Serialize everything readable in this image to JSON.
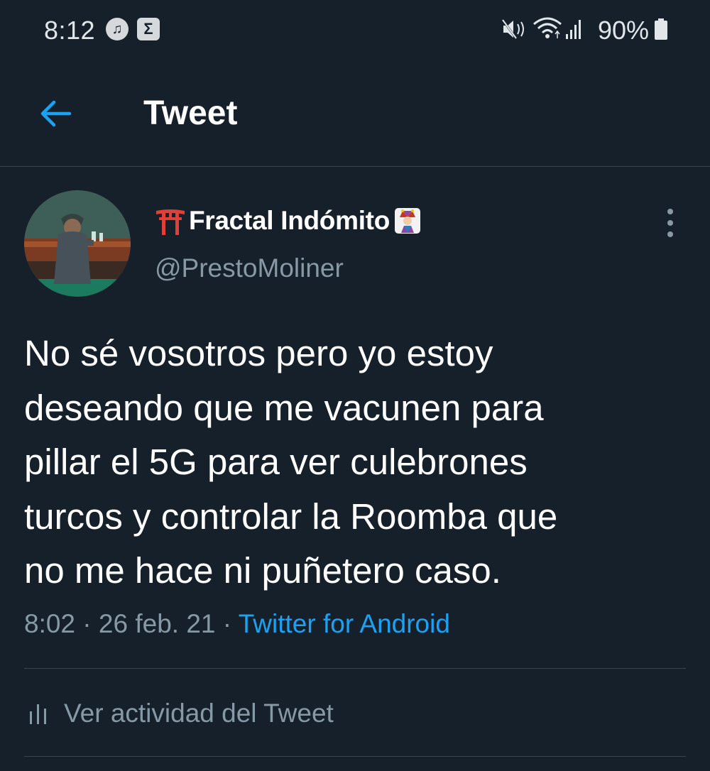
{
  "status_bar": {
    "time": "8:12",
    "battery": "90%",
    "icons": [
      "music-icon",
      "sigma-icon",
      "mute-icon",
      "wifi-icon",
      "signal-icon",
      "battery-icon"
    ]
  },
  "header": {
    "title": "Tweet",
    "back_icon": "arrow-left-icon"
  },
  "tweet": {
    "display_name": "Fractal Indómito",
    "name_emoji_left": "torii-gate-icon",
    "name_emoji_right": "jester-card-icon",
    "handle": "@PrestoMoliner",
    "text": "No sé vosotros pero yo estoy\ndeseando que me vacunen para\npillar el 5G para ver culebrones\nturcos y controlar la Roomba que\nno me hace ni puñetero caso.",
    "time": "8:02",
    "date": "26 feb. 21",
    "separator": "·",
    "source": "Twitter for Android",
    "activity_label": "Ver actividad del Tweet"
  },
  "colors": {
    "background": "#15202b",
    "accent": "#1da1f2",
    "secondary_text": "#8899a6",
    "divider": "#38444d"
  }
}
